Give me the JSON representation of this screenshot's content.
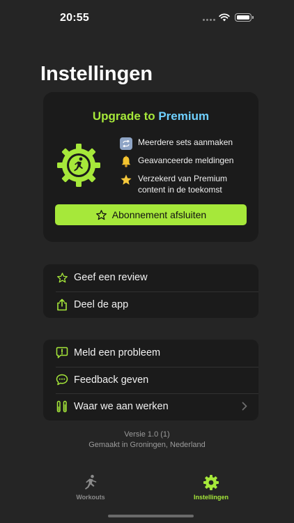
{
  "status_bar": {
    "time": "20:55"
  },
  "page": {
    "title": "Instellingen"
  },
  "premium": {
    "heading_part1": "Upgrade to ",
    "heading_part2": "Premium",
    "features": [
      {
        "icon": "repeat-icon",
        "text": "Meerdere sets aanmaken"
      },
      {
        "icon": "bell-icon",
        "text": "Geavanceerde meldingen"
      },
      {
        "icon": "star-icon",
        "text": "Verzekerd van Premium content in de toekomst"
      }
    ],
    "subscribe_label": "Abonnement afsluiten"
  },
  "groups": {
    "share": [
      {
        "icon": "star-outline-icon",
        "label": "Geef een review"
      },
      {
        "icon": "share-icon",
        "label": "Deel de app"
      }
    ],
    "support": [
      {
        "icon": "report-bubble-icon",
        "label": "Meld een probleem"
      },
      {
        "icon": "chat-bubble-icon",
        "label": "Feedback geven"
      },
      {
        "icon": "roadmap-icon",
        "label": "Waar we aan werken"
      }
    ]
  },
  "footer": {
    "version": "Versie 1.0 (1)",
    "made_in": "Gemaakt in Groningen, Nederland"
  },
  "tab_bar": {
    "tabs": [
      {
        "icon": "running-figure-icon",
        "label": "Workouts",
        "active": false
      },
      {
        "icon": "gear-icon",
        "label": "Instellingen",
        "active": true
      }
    ]
  },
  "colors": {
    "accent": "#a6e83a",
    "premium_blue": "#6fd0ff",
    "background": "#252525",
    "card": "#1b1b1b"
  }
}
